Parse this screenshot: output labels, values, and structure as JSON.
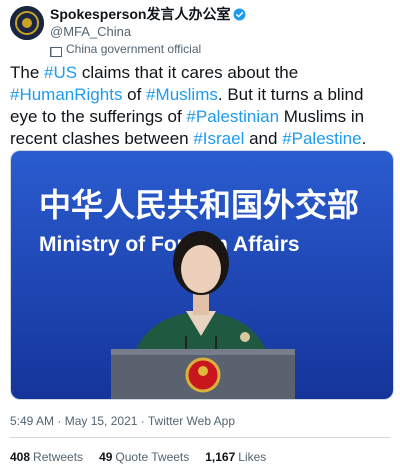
{
  "account": {
    "display_name": "Spokesperson发言人办公室",
    "handle": "@MFA_China",
    "label": "China government official",
    "verified_icon": "verified-badge-icon",
    "flag_icon": "china-flag-icon"
  },
  "tweet": {
    "segments": [
      {
        "text": "The ",
        "hashtag": false
      },
      {
        "text": "#US",
        "hashtag": true
      },
      {
        "text": " claims that it cares about the ",
        "hashtag": false
      },
      {
        "text": "#HumanRights",
        "hashtag": true
      },
      {
        "text": " of ",
        "hashtag": false
      },
      {
        "text": "#Muslims",
        "hashtag": true
      },
      {
        "text": ". But it turns a blind eye to the sufferings of ",
        "hashtag": false
      },
      {
        "text": "#Palestinian",
        "hashtag": true
      },
      {
        "text": " Muslims in recent clashes between ",
        "hashtag": false
      },
      {
        "text": "#Israel",
        "hashtag": true
      },
      {
        "text": " and ",
        "hashtag": false
      },
      {
        "text": "#Palestine",
        "hashtag": true
      },
      {
        "text": ".",
        "hashtag": false
      }
    ]
  },
  "photo": {
    "backdrop_chinese": "中华人民共和国外交部",
    "backdrop_english": "Ministry of Foreign Affairs",
    "backdrop_color": "#1b3fa0"
  },
  "meta": {
    "time": "5:49 AM",
    "separator1": " · ",
    "date": "May 15, 2021",
    "separator2": " · ",
    "source": "Twitter Web App"
  },
  "stats": {
    "retweets_count": "408",
    "retweets_label": "Retweets",
    "quotes_count": "49",
    "quotes_label": "Quote Tweets",
    "likes_count": "1,167",
    "likes_label": "Likes"
  },
  "colors": {
    "link": "#1d9bf0",
    "secondary_text": "#536471",
    "verified": "#1d9bf0"
  }
}
